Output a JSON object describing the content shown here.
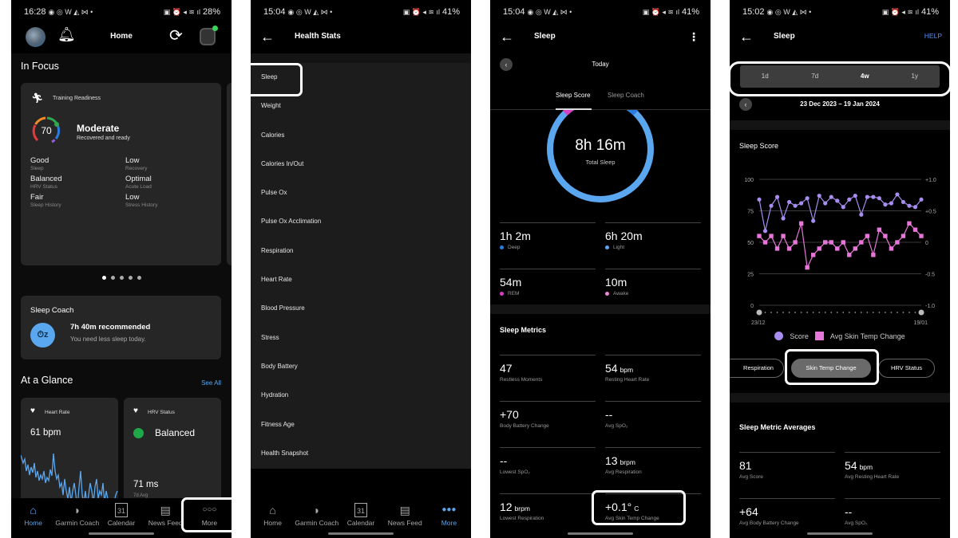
{
  "panels": {
    "home": {
      "status": {
        "time": "16:28",
        "battery": "28%"
      },
      "title": "Home",
      "in_focus": "In Focus",
      "training_readiness": {
        "label": "Training Readiness",
        "score": "70",
        "level": "Moderate",
        "subtitle": "Recovered and ready",
        "factors": [
          {
            "value": "Good",
            "label": "Sleep"
          },
          {
            "value": "Low",
            "label": "Recovery"
          },
          {
            "value": "Balanced",
            "label": "HRV Status"
          },
          {
            "value": "Optimal",
            "label": "Acute Load"
          },
          {
            "value": "Fair",
            "label": "Sleep History"
          },
          {
            "value": "Low",
            "label": "Stress History"
          }
        ]
      },
      "carousel": {
        "pages": 5,
        "active": 1
      },
      "sleep_coach": {
        "title": "Sleep Coach",
        "headline": "7h 40m recommended",
        "message": "You need less sleep today."
      },
      "at_a_glance": {
        "title": "At a Glance",
        "see_all": "See All"
      },
      "heart_rate": {
        "title": "Heart Rate",
        "value": "61 bpm"
      },
      "hrv_status": {
        "title": "HRV Status",
        "value": "Balanced",
        "ms": "71 ms",
        "avg_label": "7d Avg"
      }
    },
    "health_stats": {
      "status": {
        "time": "15:04",
        "battery": "41%"
      },
      "title": "Health Stats",
      "items": [
        "Sleep",
        "Weight",
        "Calories",
        "Calories In/Out",
        "Pulse Ox",
        "Pulse Ox Acclimation",
        "Respiration",
        "Heart Rate",
        "Blood Pressure",
        "Stress",
        "Body Battery",
        "Hydration",
        "Fitness Age",
        "Health Snapshot"
      ]
    },
    "sleep_day": {
      "status": {
        "time": "15:04",
        "battery": "41%"
      },
      "title": "Sleep",
      "date": "Today",
      "tabs": [
        "Sleep Score",
        "Sleep Coach"
      ],
      "total_sleep": {
        "value": "8h 16m",
        "label": "Total Sleep"
      },
      "stages": [
        {
          "value": "1h 2m",
          "label": "Deep",
          "color": "#2a7de0"
        },
        {
          "value": "6h 20m",
          "label": "Light",
          "color": "#5aa7f0"
        },
        {
          "value": "54m",
          "label": "REM",
          "color": "#d63fc4"
        },
        {
          "value": "10m",
          "label": "Awake",
          "color": "#e98ad9"
        }
      ],
      "metrics_title": "Sleep Metrics",
      "metrics": [
        {
          "value": "47",
          "unit": "",
          "label": "Restless Moments"
        },
        {
          "value": "54",
          "unit": "bpm",
          "label": "Resting Heart Rate"
        },
        {
          "value": "+70",
          "unit": "",
          "label": "Body Battery Change"
        },
        {
          "value": "--",
          "unit": "",
          "label": "Avg SpO₂"
        },
        {
          "value": "--",
          "unit": "",
          "label": "Lowest SpO₂"
        },
        {
          "value": "13",
          "unit": "brpm",
          "label": "Avg Respiration"
        },
        {
          "value": "12",
          "unit": "brpm",
          "label": "Lowest Respiration"
        },
        {
          "value": "+0.1°",
          "unit": "C",
          "label": "Avg Skin Temp Change"
        }
      ]
    },
    "sleep_4w": {
      "status": {
        "time": "15:02",
        "battery": "41%"
      },
      "title": "Sleep",
      "help": "HELP",
      "ranges": [
        "1d",
        "7d",
        "4w",
        "1y"
      ],
      "active_range": "4w",
      "date_range": "23 Dec 2023 – 19 Jan 2024",
      "chips": [
        "Respiration",
        "Skin Temp Change",
        "HRV Status"
      ],
      "active_chip": "Skin Temp Change",
      "averages_title": "Sleep Metric Averages",
      "averages": [
        {
          "value": "81",
          "unit": "",
          "label": "Avg Score"
        },
        {
          "value": "54",
          "unit": "bpm",
          "label": "Avg Resting Heart Rate"
        },
        {
          "value": "+64",
          "unit": "",
          "label": "Avg Body Battery Change"
        },
        {
          "value": "--",
          "unit": "",
          "label": "Avg SpO₂"
        }
      ]
    }
  },
  "nav": {
    "items": [
      {
        "label": "Home",
        "icon": "home-icon"
      },
      {
        "label": "Garmin Coach",
        "icon": "whistle-icon"
      },
      {
        "label": "Calendar",
        "icon": "calendar-icon",
        "day": "31"
      },
      {
        "label": "News Feed",
        "icon": "newspaper-icon"
      },
      {
        "label": "More",
        "icon": "more-icon"
      }
    ]
  },
  "chart_data": {
    "type": "line",
    "title": "Sleep Score",
    "x_start_label": "23/12",
    "x_end_label": "19/01",
    "points": 28,
    "y_left": {
      "ticks": [
        "100",
        "75",
        "50",
        "25",
        "0"
      ],
      "range": [
        0,
        100
      ]
    },
    "y_right": {
      "ticks": [
        "+1.0",
        "+0.5",
        "0",
        "-0.5",
        "-1.0"
      ],
      "range": [
        -1.0,
        1.0
      ]
    },
    "grid": true,
    "legend_position": "bottom",
    "series": [
      {
        "name": "Score",
        "axis": "left",
        "marker": "circle",
        "color": "#a78df0",
        "values": [
          84,
          59,
          79,
          86,
          69,
          82,
          79,
          81,
          85,
          67,
          87,
          81,
          86,
          83,
          78,
          84,
          87,
          72,
          86,
          86,
          85,
          80,
          81,
          88,
          82,
          79,
          78,
          84
        ]
      },
      {
        "name": "Avg Skin Temp Change",
        "axis": "right",
        "marker": "square",
        "color": "#e676d8",
        "values": [
          0.1,
          0.0,
          0.1,
          -0.1,
          0.1,
          -0.1,
          0.0,
          0.3,
          -0.4,
          -0.2,
          -0.1,
          0.0,
          0.0,
          -0.1,
          0.0,
          -0.2,
          -0.1,
          0.0,
          0.1,
          -0.2,
          0.2,
          0.1,
          -0.1,
          0.0,
          0.1,
          0.3,
          0.2,
          0.1
        ]
      }
    ]
  },
  "colors": {
    "accent": "#5aa7f0",
    "ring_light": "#5aa7f0",
    "ring_deep": "#2a7de0",
    "ring_rem": "#d63fc4"
  }
}
